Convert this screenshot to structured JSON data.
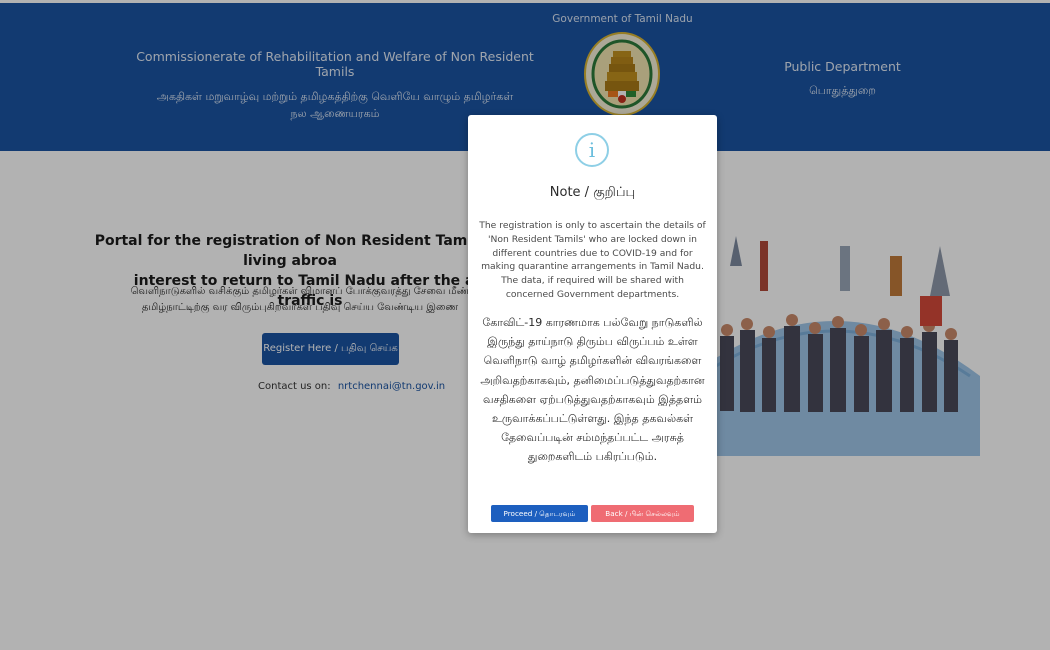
{
  "header": {
    "left_en": "Commissionerate of Rehabilitation and Welfare of Non Resident Tamils",
    "left_ta": "அகதிகள் மறுவாழ்வு மற்றும் தமிழகத்திற்கு வெளியே வாழும் தமிழர்கள் நல ஆணையரகம்",
    "gov_label": "Government of Tamil Nadu",
    "emblem_icon": "tamil-nadu-emblem-icon",
    "right_en": "Public Department",
    "right_ta": "பொதுத்துறை",
    "background_color": "#1b54a3"
  },
  "main": {
    "title_line1": "Portal for the registration of Non Resident Tamils living abroa",
    "title_line2": "interest to return to Tamil Nadu after the air traffic is",
    "subtitle_ta_line1": "வெளிநாடுகளில் வசிக்கும் தமிழர்கள் விமானப் போக்குவரத்து சேவை மீண்",
    "subtitle_ta_line2": "தமிழ்நாட்டிற்கு வர விரும்புகிறவர்கள் பதிவு செய்ய வேண்டிய இணை",
    "register_label": "Register Here / பதிவு செய்க",
    "contact_label": "Contact us on:",
    "contact_email": "nrtchennai@tn.gov.in",
    "illustration_icon": "travellers-globe-illustration"
  },
  "modal": {
    "icon": "info-icon",
    "title": "Note / குறிப்பு",
    "text_en": "The registration is only to ascertain the details of 'Non Resident Tamils' who are locked down in different countries due to COVID-19 and for making quarantine arrangements in Tamil Nadu. The data, if required will be shared with concerned Government departments.",
    "text_ta": "கோவிட்-19 காரணமாக பல்வேறு நாடுகளில் இருந்து தாய்நாடு திரும்ப விருப்பம் உள்ள வெளிநாடு வாழ் தமிழர்களின் விவரங்களை அறிவதற்காகவும், தனிமைப்படுத்துவதற்கான வசதிகளை ஏற்படுத்துவதற்காகவும் இத்தளம் உருவாக்கப்பட்டுள்ளது. இந்த தகவல்கள் தேவைப்படின் சம்மந்தப்பட்ட அரசுத் துறைகளிடம் பகிரப்படும்.",
    "proceed_label": "Proceed / தொடரவும்",
    "back_label": "Back / பின் செல்லவும்",
    "proceed_color": "#1d5fbf",
    "back_color": "#ef6c73"
  }
}
